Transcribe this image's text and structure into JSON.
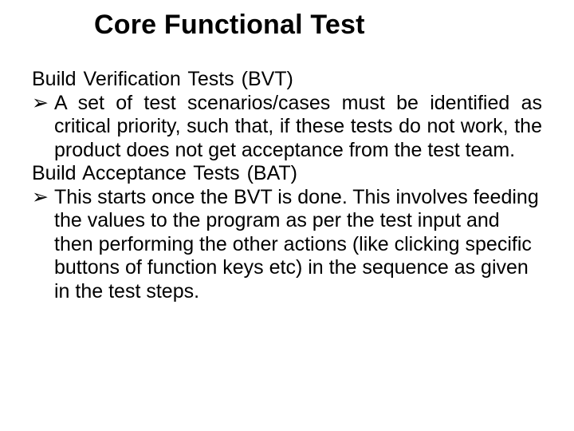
{
  "title": "Core Functional Test",
  "section1": {
    "heading": "Build  Verification  Tests  (BVT)",
    "bullet_marker": "➢",
    "bullet_text": "A set of test scenarios/cases must be identified as critical priority,  such  that,  if  these  tests  do  not work,  the  product  does  not  get acceptance from the test team."
  },
  "section2": {
    "heading": "Build  Acceptance  Tests  (BAT)",
    "bullet_marker": "➢",
    "bullet_text": "This starts once the BVT is done. This  involves feeding  the  values  to  the  program  as per the test input and then performing the other actions (like clicking specific buttons of function keys etc) in the sequence as given in the test steps."
  }
}
